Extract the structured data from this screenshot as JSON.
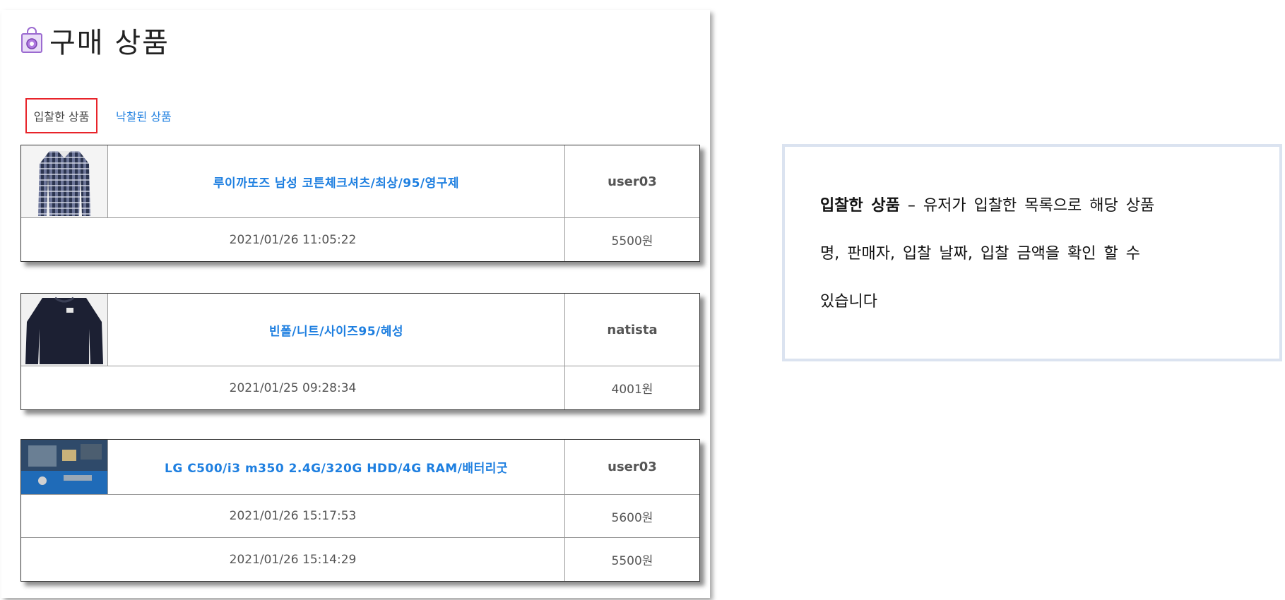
{
  "page": {
    "title": "구매 상품",
    "title_icon": "shopping-bag-icon"
  },
  "tabs": [
    {
      "label": "입찰한 상품",
      "active": true
    },
    {
      "label": "낙찰된 상품",
      "active": false
    }
  ],
  "items": [
    {
      "name": "루이까또즈 남성 코튼체크셔츠/최상/95/영구제",
      "seller": "user03",
      "thumb": "checkered-shirt-image",
      "bids": [
        {
          "date": "2021/01/26 11:05:22",
          "price": "5500원"
        }
      ]
    },
    {
      "name": "빈폴/니트/사이즈95/혜성",
      "seller": "natista",
      "thumb": "navy-knit-sweater-image",
      "bids": [
        {
          "date": "2021/01/25 09:28:34",
          "price": "4001원"
        }
      ]
    },
    {
      "name": "LG C500/i3 m350 2.4G/320G HDD/4G RAM/배터리굿",
      "seller": "user03",
      "thumb": "laptop-motherboard-image",
      "bids": [
        {
          "date": "2021/01/26 15:17:53",
          "price": "5600원"
        },
        {
          "date": "2021/01/26 15:14:29",
          "price": "5500원"
        }
      ]
    }
  ],
  "note": {
    "heading": "입찰한 상품",
    "line1": " – 유저가 입찰한 목록으로 해당 상품",
    "line2": "명, 판매자, 입찰 날짜, 입찰 금액을 확인 할 수",
    "line3": "있습니다"
  },
  "colors": {
    "link": "#1e7fe0",
    "active_tab_border": "#e8242a",
    "note_border": "#dbe3f0"
  }
}
